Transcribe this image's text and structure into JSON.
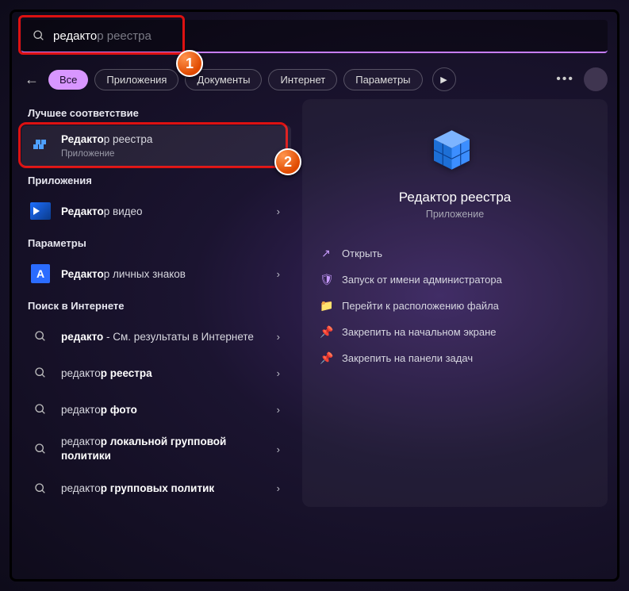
{
  "search": {
    "typed": "редакто",
    "ghost_completion": "р реестра"
  },
  "filters": {
    "all": "Все",
    "apps": "Приложения",
    "docs": "Документы",
    "web": "Интернет",
    "settings": "Параметры"
  },
  "sections": {
    "best_match": "Лучшее соответствие",
    "apps": "Приложения",
    "settings": "Параметры",
    "web": "Поиск в Интернете"
  },
  "best": {
    "title_bold": "Редакто",
    "title_rest": "р реестра",
    "subtitle": "Приложение"
  },
  "apps_list": [
    {
      "icon": "video",
      "bold": "Редакто",
      "rest": "р видео"
    }
  ],
  "settings_list": [
    {
      "icon": "font",
      "bold": "Редакто",
      "rest": "р личных знаков"
    }
  ],
  "web_list": [
    {
      "bold": "редакто",
      "rest": " - См. результаты в Интернете"
    },
    {
      "norm": "редакто",
      "bold": "р реестра"
    },
    {
      "norm": "редакто",
      "bold": "р фото"
    },
    {
      "norm": "редакто",
      "bold": "р локальной групповой политики"
    },
    {
      "norm": "редакто",
      "bold": "р групповых политик"
    }
  ],
  "preview": {
    "title": "Редактор реестра",
    "subtitle": "Приложение",
    "actions": [
      {
        "icon": "↗",
        "label": "Открыть"
      },
      {
        "icon": "🛡",
        "label": "Запуск от имени администратора"
      },
      {
        "icon": "📁",
        "label": "Перейти к расположению файла"
      },
      {
        "icon": "📌",
        "label": "Закрепить на начальном экране"
      },
      {
        "icon": "📌",
        "label": "Закрепить на панели задач"
      }
    ]
  },
  "badges": {
    "b1": "1",
    "b2": "2"
  }
}
